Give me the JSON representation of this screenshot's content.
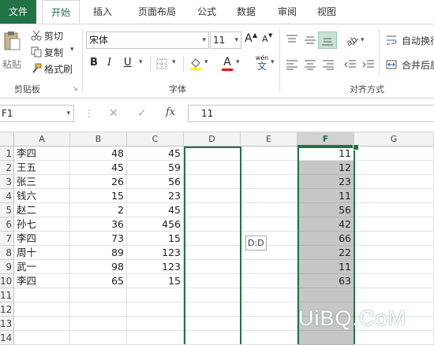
{
  "tabs": [
    "文件",
    "开始",
    "插入",
    "页面布局",
    "公式",
    "数据",
    "审阅",
    "视图"
  ],
  "clipboard": {
    "paste": "粘贴",
    "cut": "剪切",
    "copy": "复制",
    "format_painter": "格式刷",
    "group_label": "剪贴板"
  },
  "font": {
    "name": "宋体",
    "size": "11",
    "bold": "B",
    "italic": "I",
    "underline": "U",
    "font_color_letter": "A",
    "grow": "A",
    "shrink": "A",
    "wen": "wén",
    "group_label": "字体"
  },
  "alignment": {
    "wrap_text": "自动换行",
    "merge_center": "合并后居",
    "group_label": "对齐方式"
  },
  "formula_bar": {
    "name_box": "F1",
    "fx": "fx",
    "value": "11"
  },
  "columns": [
    "A",
    "B",
    "C",
    "D",
    "E",
    "F",
    "G"
  ],
  "rows": [
    "1",
    "2",
    "3",
    "4",
    "5",
    "6",
    "7",
    "8",
    "9",
    "10",
    "11",
    "12",
    "13",
    "14"
  ],
  "cells": [
    [
      "李四",
      "48",
      "45",
      "",
      "",
      "11",
      ""
    ],
    [
      "王五",
      "45",
      "59",
      "",
      "",
      "12",
      ""
    ],
    [
      "张三",
      "26",
      "56",
      "",
      "",
      "23",
      ""
    ],
    [
      "钱六",
      "15",
      "23",
      "",
      "",
      "11",
      ""
    ],
    [
      "赵二",
      "2",
      "45",
      "",
      "",
      "56",
      ""
    ],
    [
      "孙七",
      "36",
      "456",
      "",
      "",
      "42",
      ""
    ],
    [
      "李四",
      "73",
      "15",
      "",
      "",
      "66",
      ""
    ],
    [
      "周十",
      "89",
      "123",
      "",
      "",
      "22",
      ""
    ],
    [
      "武一",
      "98",
      "123",
      "",
      "",
      "11",
      ""
    ],
    [
      "李四",
      "65",
      "15",
      "",
      "",
      "63",
      ""
    ],
    [
      "",
      "",
      "",
      "",
      "",
      "",
      ""
    ],
    [
      "",
      "",
      "",
      "",
      "",
      "",
      ""
    ],
    [
      "",
      "",
      "",
      "",
      "",
      "",
      ""
    ],
    [
      "",
      "",
      "",
      "",
      "",
      "",
      ""
    ]
  ],
  "tooltip": "D:D",
  "watermark": "UiBQ.CoM",
  "colors": {
    "accent": "#217346",
    "selection": "#c6c6c6"
  }
}
